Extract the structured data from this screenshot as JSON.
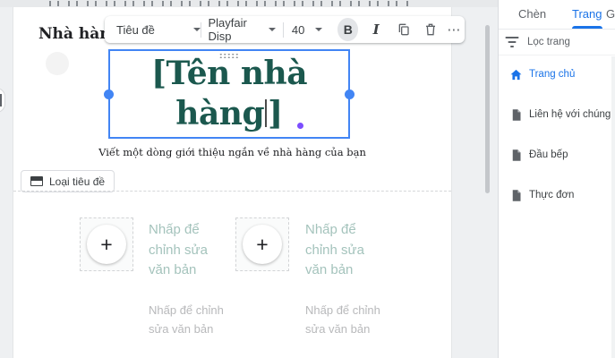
{
  "site": {
    "name": "Nhà hàng"
  },
  "toolbar": {
    "style_select_value": "Tiêu đề",
    "font_select_value": "Playfair Disp",
    "size_select_value": "40",
    "bold_glyph": "B",
    "italic_glyph": "I",
    "more_glyph": "⋯"
  },
  "canvas": {
    "title_line1": "[Tên nhà",
    "title_line2_a": "hàng",
    "title_line2_b": "]",
    "title_full": "[Tên nhà hàng]",
    "subtitle": "Viết một dòng giới thiệu ngắn về nhà hàng của bạn",
    "header_type_button_label": "Loại tiêu đề",
    "add_glyph": "+",
    "blocks": [
      {
        "heading_lines": [
          "Nhấp để",
          "chỉnh sửa",
          "văn bản"
        ],
        "body_lines": [
          "Nhấp để chỉnh",
          "sửa văn bản"
        ]
      },
      {
        "heading_lines": [
          "Nhấp để",
          "chỉnh sửa",
          "văn bản"
        ],
        "body_lines": [
          "Nhấp để chỉnh",
          "sửa văn bản"
        ]
      }
    ]
  },
  "sidebar": {
    "tabs": [
      {
        "label": "Chèn",
        "active": false
      },
      {
        "label": "Trang",
        "active": true
      },
      {
        "label": "Gi",
        "active": false
      }
    ],
    "filter_placeholder": "Lọc trang",
    "pages": [
      {
        "label": "Trang chủ",
        "icon": "home-icon",
        "active": true
      },
      {
        "label": "Liên hệ với chúng tôi",
        "icon": "page-icon",
        "active": false
      },
      {
        "label": "Đầu bếp",
        "icon": "page-icon",
        "active": false
      },
      {
        "label": "Thực đơn",
        "icon": "page-icon",
        "active": false
      }
    ]
  },
  "colors": {
    "accent_blue": "#1a73e8",
    "selection_blue": "#4285f4",
    "title_green": "#1b584e",
    "placeholder_teal": "#a4c3bc",
    "placeholder_gray": "#b8b9bb",
    "collaborator_purple": "#7c4dff"
  }
}
